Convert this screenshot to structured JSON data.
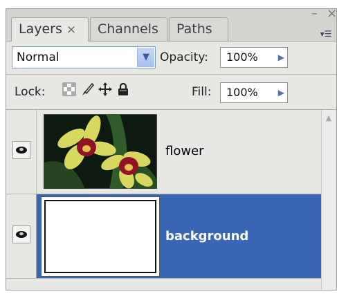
{
  "tabs": [
    {
      "label": "Layers",
      "close": "×",
      "active": true
    },
    {
      "label": "Channels",
      "active": false
    },
    {
      "label": "Paths",
      "active": false
    }
  ],
  "window": {
    "minimize": "–",
    "close": "×",
    "menu": "▾☰"
  },
  "blend_mode": {
    "value": "Normal",
    "dropdown_glyph": "▼"
  },
  "opacity": {
    "label": "Opacity:",
    "value": "100%",
    "arrow": "▶"
  },
  "lock": {
    "label": "Lock:"
  },
  "fill": {
    "label": "Fill:",
    "value": "100%",
    "arrow": "▶"
  },
  "layers": [
    {
      "name": "flower",
      "visible": true,
      "selected": false
    },
    {
      "name": "background",
      "visible": true,
      "selected": true
    }
  ],
  "scroll": {
    "up": "▲"
  },
  "colors": {
    "selection": "#3a66b6",
    "panel": "#e7e7e4"
  },
  "icons": [
    "eye-icon",
    "lock-transparent-icon",
    "lock-image-brush-icon",
    "lock-position-move-icon",
    "lock-all-padlock-icon"
  ]
}
